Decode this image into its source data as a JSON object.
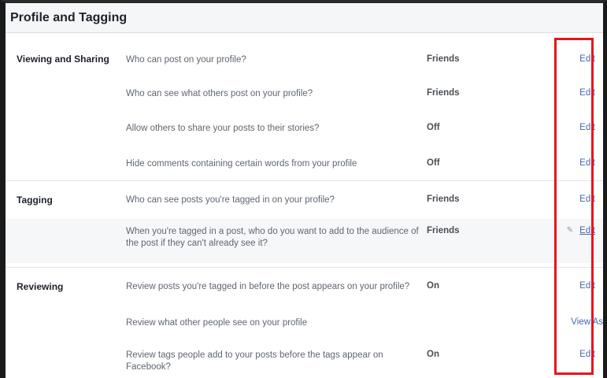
{
  "header": {
    "title": "Profile and Tagging"
  },
  "sections": [
    {
      "title": "Viewing and Sharing",
      "rows": [
        {
          "question": "Who can post on your profile?",
          "value": "Friends",
          "action": "Edit"
        },
        {
          "question": "Who can see what others post on your profile?",
          "value": "Friends",
          "action": "Edit"
        },
        {
          "question": "Allow others to share your posts to their stories?",
          "value": "Off",
          "action": "Edit"
        },
        {
          "question": "Hide comments containing certain words from your profile",
          "value": "Off",
          "action": "Edit"
        }
      ]
    },
    {
      "title": "Tagging",
      "rows": [
        {
          "question": "Who can see posts you're tagged in on your profile?",
          "value": "Friends",
          "action": "Edit"
        },
        {
          "question": "When you're tagged in a post, who do you want to add to the audience of the post if they can't already see it?",
          "value": "Friends",
          "action": "Edit"
        }
      ]
    },
    {
      "title": "Reviewing",
      "rows": [
        {
          "question": "Review posts you're tagged in before the post appears on your profile?",
          "value": "On",
          "action": "Edit"
        },
        {
          "question": "Review what other people see on your profile",
          "value": "",
          "action": "View As"
        },
        {
          "question": "Review tags people add to your posts before the tags appear on Facebook?",
          "value": "On",
          "action": "Edit"
        }
      ]
    }
  ],
  "colors": {
    "link": "#4267b2",
    "highlight_box": "#e8141d"
  },
  "icons": {
    "edit_hover": "pencil-icon"
  }
}
